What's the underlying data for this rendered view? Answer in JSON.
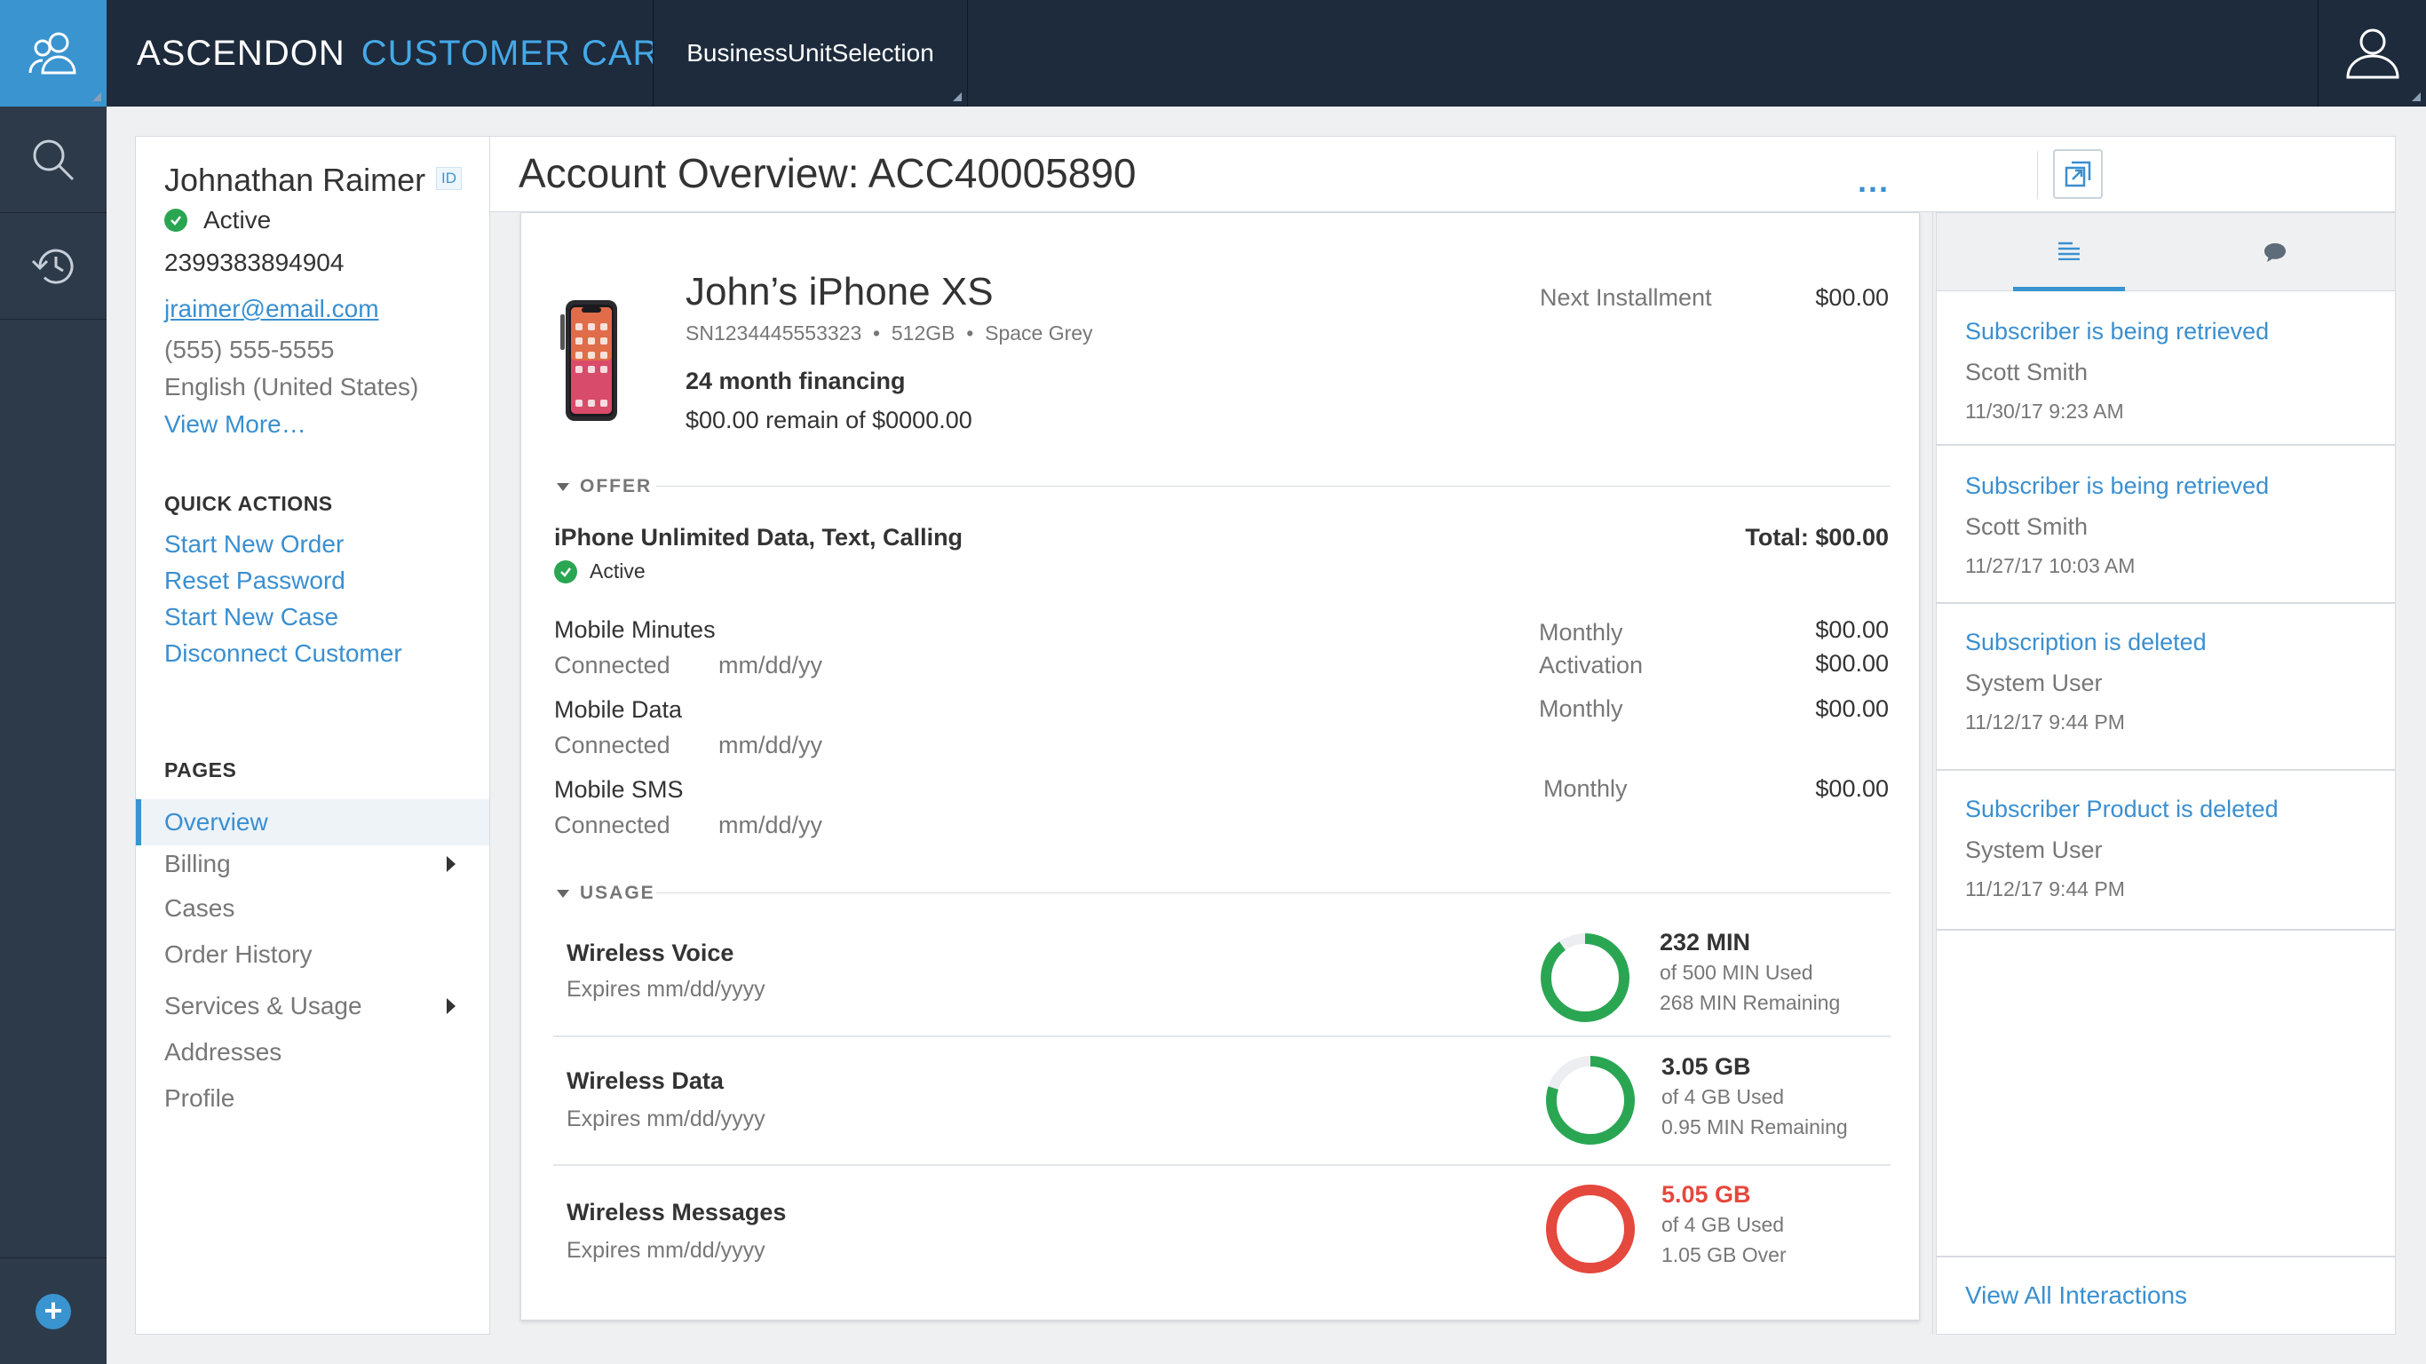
{
  "app": {
    "brand": "ASCENDON",
    "product": "CUSTOMER CARE",
    "business_unit": "BusinessUnitSelection"
  },
  "icons": {
    "top_left": "customers-icon",
    "rail": [
      "search-icon",
      "history-icon"
    ],
    "rail_bottom": "add-icon",
    "user": "user-icon"
  },
  "colors": {
    "accent": "#3a94cf",
    "topbar": "#1d2b3c",
    "rail": "#2c3a4a",
    "success": "#2aa653",
    "danger": "#e5483d"
  },
  "customer": {
    "name": "Johnathan Raimer",
    "id_badge": "ID",
    "status": "Active",
    "account_number": "2399383894904",
    "email": "jraimer@email.com",
    "phone": "(555) 555-5555",
    "language": "English (United States)",
    "view_more": "View More…"
  },
  "quick_actions": {
    "label": "QUICK ACTIONS",
    "items": [
      "Start New Order",
      "Reset Password",
      "Start New Case",
      "Disconnect Customer"
    ]
  },
  "pages": {
    "label": "PAGES",
    "items": [
      {
        "label": "Overview",
        "active": true,
        "arrow": false
      },
      {
        "label": "Billing",
        "active": false,
        "arrow": true
      },
      {
        "label": "Cases",
        "active": false,
        "arrow": false
      },
      {
        "label": "Order History",
        "active": false,
        "arrow": false
      },
      {
        "label": "Services & Usage",
        "active": false,
        "arrow": true
      },
      {
        "label": "Addresses",
        "active": false,
        "arrow": false
      },
      {
        "label": "Profile",
        "active": false,
        "arrow": false
      }
    ]
  },
  "header": {
    "title": "Account Overview: ACC40005890",
    "more": "..."
  },
  "device": {
    "name": "John’s iPhone XS",
    "serial": "SN1234445553323",
    "capacity": "512GB",
    "color": "Space Grey",
    "financing": "24 month financing",
    "remaining": "$00.00 remain of $0000.00",
    "next_installment_label": "Next Installment",
    "next_installment_value": "$00.00"
  },
  "offer": {
    "section": "OFFER",
    "name": "iPhone Unlimited Data, Text, Calling",
    "status": "Active",
    "total": "Total: $00.00",
    "services": [
      {
        "name": "Mobile Minutes",
        "status": "Connected",
        "date": "mm/dd/yy",
        "charges": [
          {
            "label": "Monthly",
            "value": "$00.00"
          },
          {
            "label": "Activation",
            "value": "$00.00"
          }
        ]
      },
      {
        "name": "Mobile Data",
        "status": "Connected",
        "date": "mm/dd/yy",
        "charges": [
          {
            "label": "Monthly",
            "value": "$00.00"
          }
        ]
      },
      {
        "name": "Mobile SMS",
        "status": "Connected",
        "date": "mm/dd/yy",
        "charges": [
          {
            "label": "Monthly",
            "value": "$00.00"
          }
        ]
      }
    ]
  },
  "usage": {
    "section": "USAGE",
    "items": [
      {
        "name": "Wireless Voice",
        "expires": "Expires mm/dd/yyyy",
        "amount": "232 MIN",
        "of": "of 500 MIN Used",
        "remaining": "268 MIN Remaining",
        "fraction": 0.9,
        "over": false
      },
      {
        "name": "Wireless Data",
        "expires": "Expires mm/dd/yyyy",
        "amount": "3.05 GB",
        "of": "of 4 GB Used",
        "remaining": "0.95 MIN Remaining",
        "fraction": 0.8,
        "over": false
      },
      {
        "name": "Wireless Messages",
        "expires": "Expires mm/dd/yyyy",
        "amount": "5.05 GB",
        "of": "of 4 GB Used",
        "remaining": "1.05 GB Over",
        "fraction": 1.0,
        "over": true
      }
    ]
  },
  "interactions": {
    "events": [
      {
        "title": "Subscriber is being retrieved",
        "user": "Scott Smith",
        "time": "11/30/17 9:23 AM"
      },
      {
        "title": "Subscriber is being retrieved",
        "user": "Scott Smith",
        "time": "11/27/17 10:03 AM"
      },
      {
        "title": "Subscription is deleted",
        "user": "System User",
        "time": "11/12/17 9:44 PM"
      },
      {
        "title": "Subscriber Product is deleted",
        "user": "System User",
        "time": "11/12/17 9:44 PM"
      }
    ],
    "view_all": "View All Interactions"
  }
}
